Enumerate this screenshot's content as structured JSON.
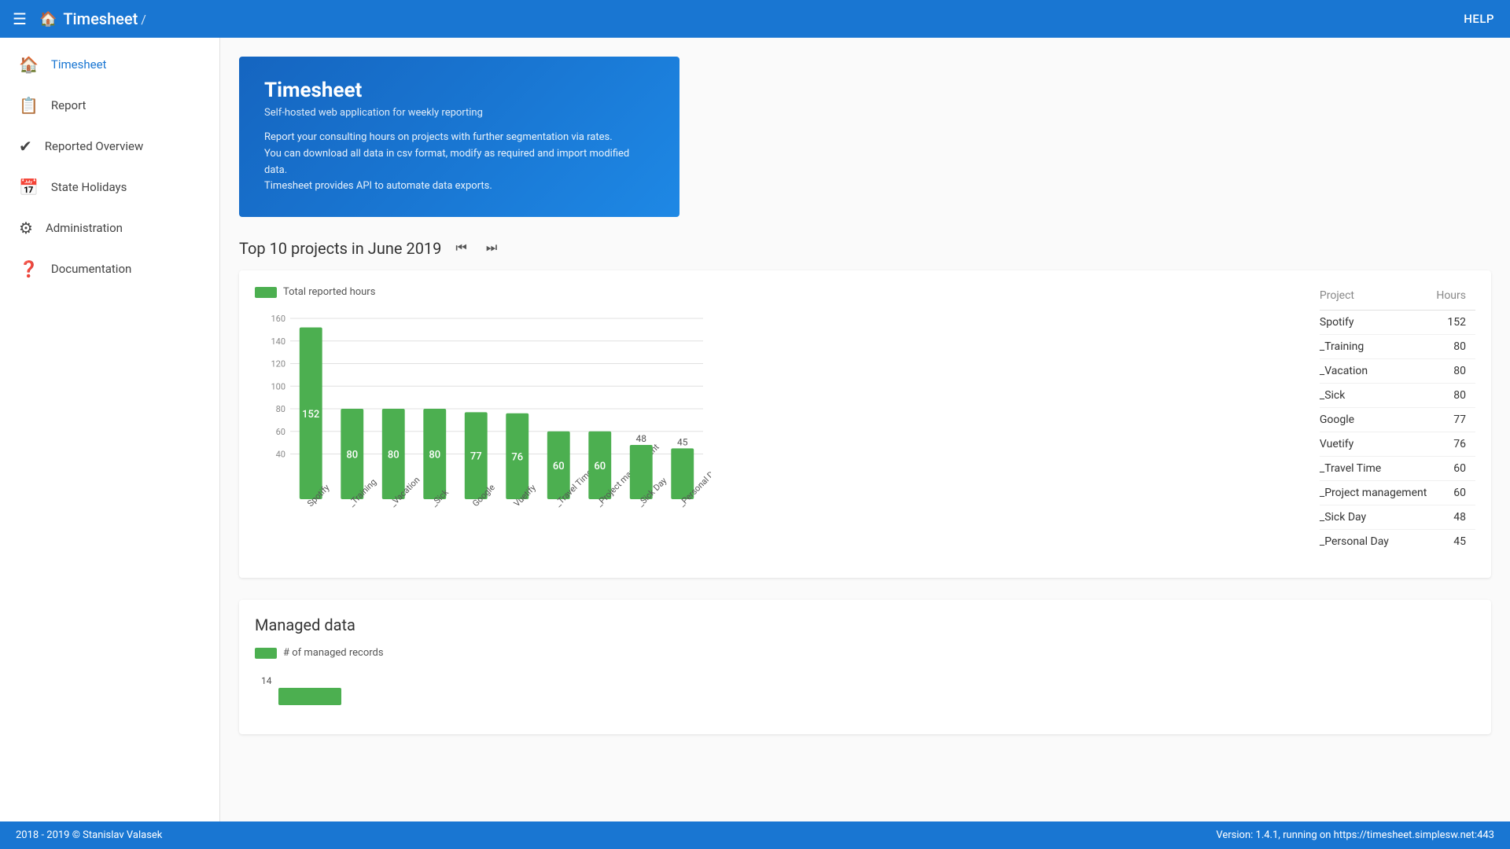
{
  "topNav": {
    "menuIcon": "☰",
    "homeIcon": "⌂",
    "title": "Timesheet",
    "breadcrumbSep": "/",
    "helpLabel": "HELP"
  },
  "sidebar": {
    "items": [
      {
        "id": "timesheet",
        "label": "Timesheet",
        "icon": "🏠",
        "active": true
      },
      {
        "id": "report",
        "label": "Report",
        "icon": "📋",
        "active": false
      },
      {
        "id": "reported-overview",
        "label": "Reported Overview",
        "icon": "✔",
        "active": false
      },
      {
        "id": "state-holidays",
        "label": "State Holidays",
        "icon": "📅",
        "active": false
      },
      {
        "id": "administration",
        "label": "Administration",
        "icon": "⚙",
        "active": false
      },
      {
        "id": "documentation",
        "label": "Documentation",
        "icon": "❓",
        "active": false
      }
    ]
  },
  "hero": {
    "title": "Timesheet",
    "subtitle": "Self-hosted web application for weekly reporting",
    "desc1": "Report your consulting hours on projects with further segmentation via rates.",
    "desc2": "You can download all data in csv format, modify as required and import modified data.",
    "desc3": "Timesheet provides API to automate data exports."
  },
  "chart": {
    "sectionTitle": "Top 10 projects in June 2019",
    "prevIcon": "⏮",
    "nextIcon": "⏭",
    "legendLabel": "Total reported hours",
    "yMax": 160,
    "yMin": 40,
    "bars": [
      {
        "label": "Spotify",
        "value": 152,
        "color": "#4CAF50"
      },
      {
        "label": "_Training",
        "value": 80,
        "color": "#4CAF50"
      },
      {
        "label": "_Vacation",
        "value": 80,
        "color": "#4CAF50"
      },
      {
        "label": "_Sick",
        "value": 80,
        "color": "#4CAF50"
      },
      {
        "label": "Google",
        "value": 77,
        "color": "#4CAF50"
      },
      {
        "label": "Vuetify",
        "value": 76,
        "color": "#4CAF50"
      },
      {
        "label": "_Travel Time",
        "value": 60,
        "color": "#4CAF50"
      },
      {
        "label": "_Project management",
        "value": 60,
        "color": "#4CAF50"
      },
      {
        "label": "_Sick Day",
        "value": 48,
        "color": "#4CAF50"
      },
      {
        "label": "_Personal Day",
        "value": 45,
        "color": "#4CAF50"
      }
    ],
    "tableHeaders": [
      "Project",
      "Hours"
    ],
    "tableRows": [
      {
        "project": "Spotify",
        "hours": "152"
      },
      {
        "project": "_Training",
        "hours": "80"
      },
      {
        "project": "_Vacation",
        "hours": "80"
      },
      {
        "project": "_Sick",
        "hours": "80"
      },
      {
        "project": "Google",
        "hours": "77"
      },
      {
        "project": "Vuetify",
        "hours": "76"
      },
      {
        "project": "_Travel Time",
        "hours": "60"
      },
      {
        "project": "_Project management",
        "hours": "60"
      },
      {
        "project": "_Sick Day",
        "hours": "48"
      },
      {
        "project": "_Personal Day",
        "hours": "45"
      }
    ]
  },
  "managed": {
    "title": "Managed data",
    "legendLabel": "# of managed records",
    "previewValue": 14
  },
  "footer": {
    "copyright": "2018 - 2019 © Stanislav Valasek",
    "version": "Version: 1.4.1, running on https://timesheet.simplesw.net:443"
  }
}
